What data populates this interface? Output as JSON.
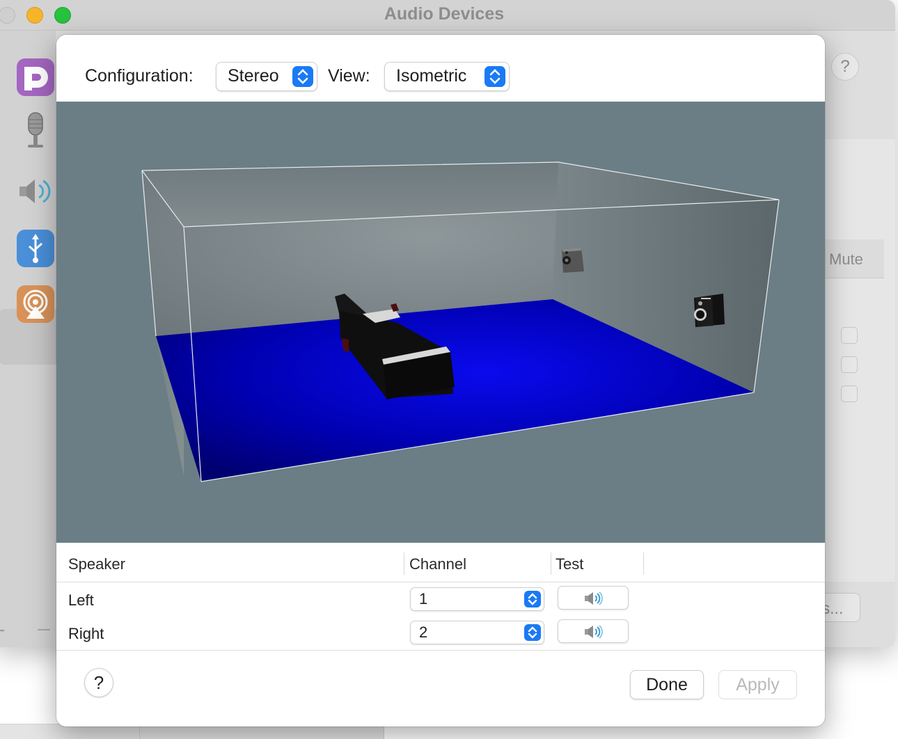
{
  "window": {
    "title": "Audio Devices"
  },
  "sidebar": {
    "devices": [
      {
        "icon": "pd-app-icon"
      },
      {
        "icon": "microphone-icon"
      },
      {
        "icon": "speaker-icon"
      },
      {
        "icon": "usb-icon"
      },
      {
        "icon": "airplay-icon",
        "selected": true
      }
    ],
    "add_label": "+"
  },
  "background_panel": {
    "help_label": "?",
    "mute_header": "Mute",
    "button_label": "rs..."
  },
  "dialog": {
    "configuration": {
      "label": "Configuration:",
      "value": "Stereo"
    },
    "view": {
      "label": "View:",
      "value": "Isometric"
    },
    "table": {
      "headers": {
        "speaker": "Speaker",
        "channel": "Channel",
        "test": "Test"
      },
      "rows": [
        {
          "speaker": "Left",
          "channel": "1",
          "test_icon": "speaker-test-icon"
        },
        {
          "speaker": "Right",
          "channel": "2",
          "test_icon": "speaker-test-icon"
        }
      ]
    },
    "buttons": {
      "help": "?",
      "done": "Done",
      "apply": "Apply"
    }
  },
  "colors": {
    "accent": "#1a7af5",
    "floor": "#0000c8",
    "viewport_background": "#6b7e86",
    "traffic_min": "#f6b42a",
    "traffic_max": "#27c23f"
  }
}
